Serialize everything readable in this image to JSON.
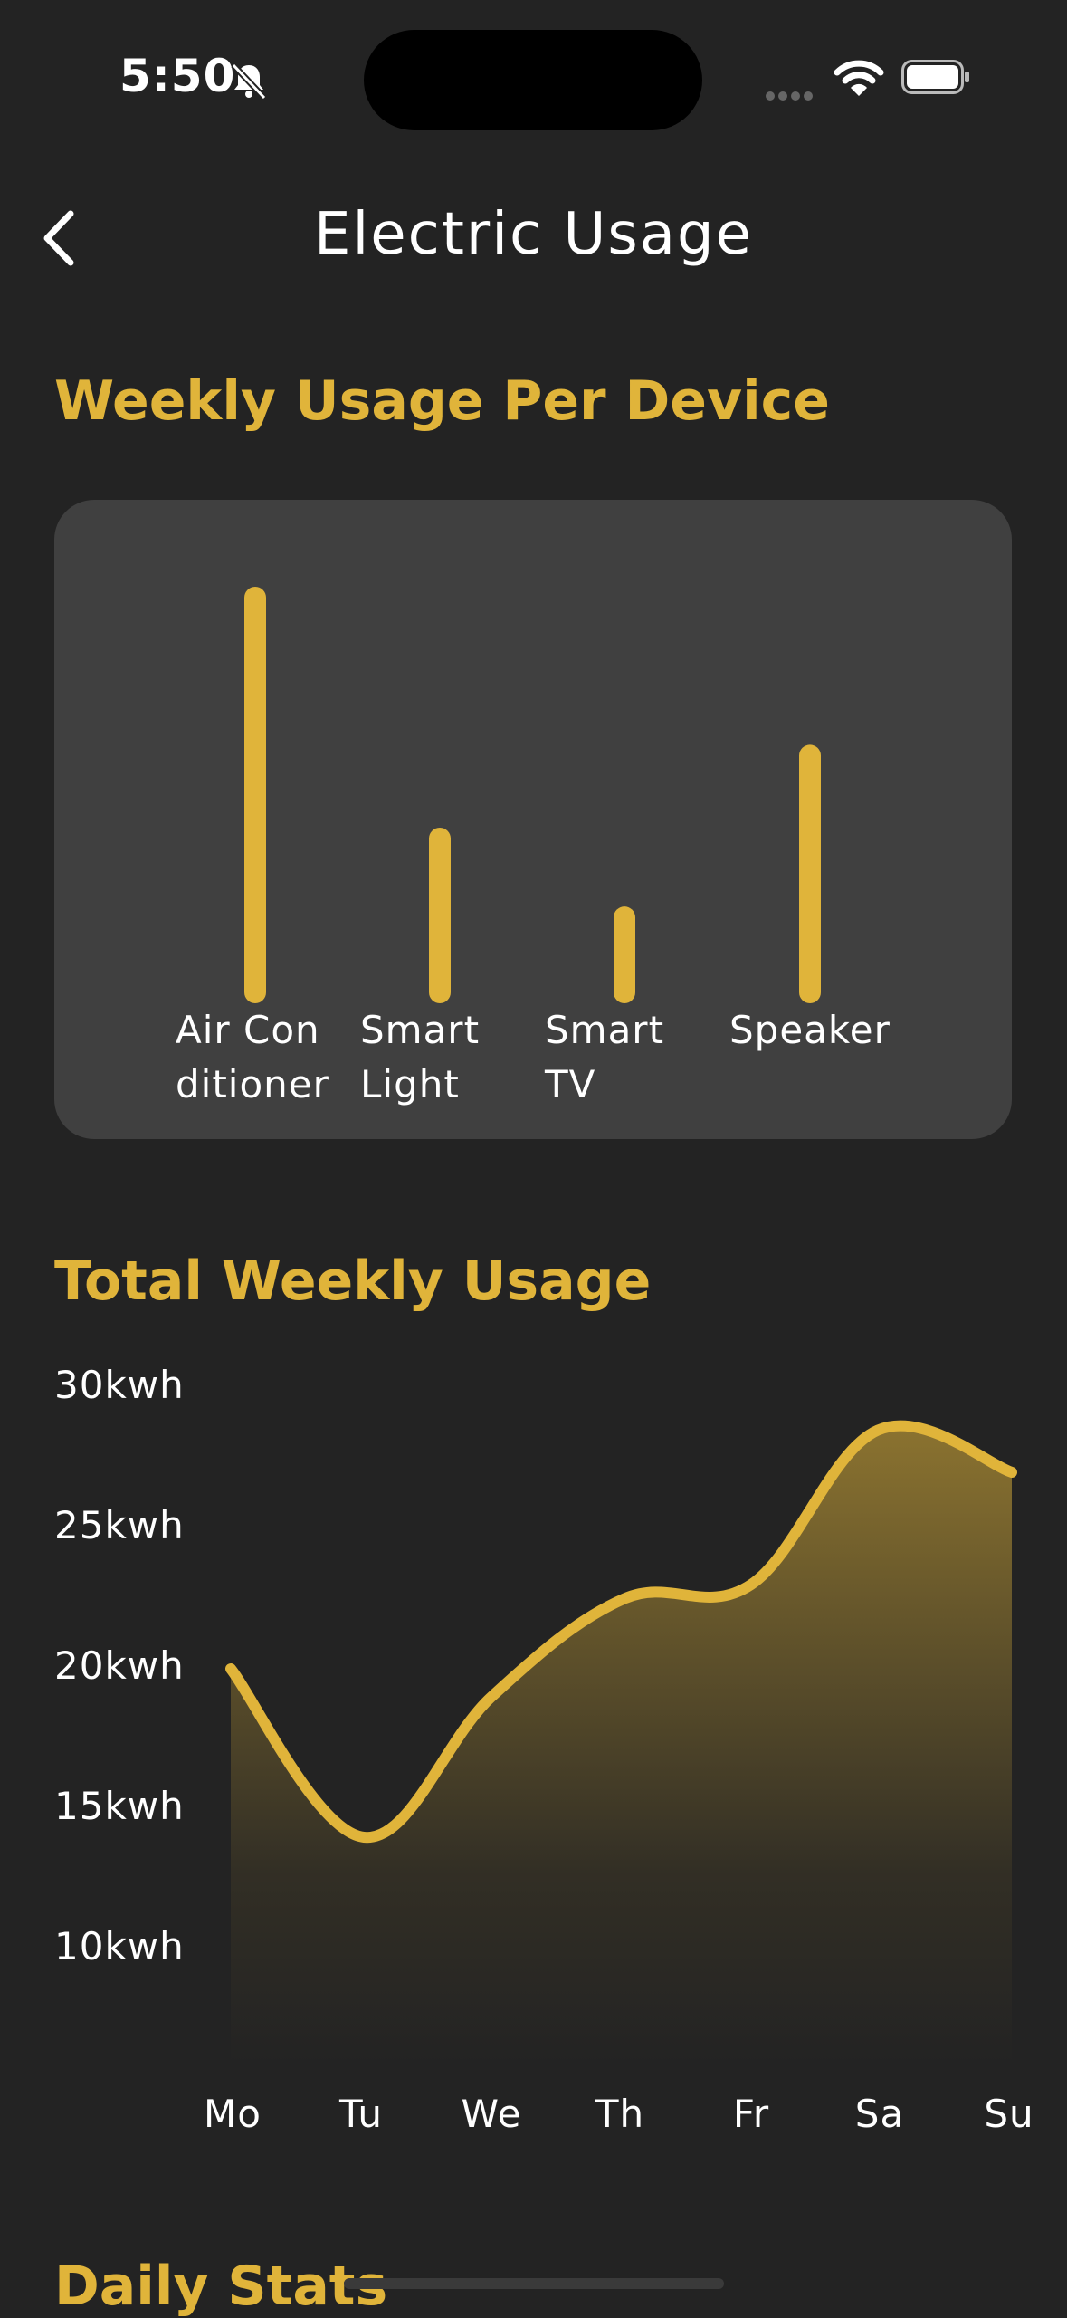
{
  "status_bar": {
    "time": "5:50"
  },
  "nav": {
    "title": "Electric Usage"
  },
  "sections": {
    "per_device": "Weekly Usage Per Device",
    "total": "Total Weekly Usage",
    "daily": "Daily Stats"
  },
  "colors": {
    "accent": "#E0B43A",
    "background": "#232323",
    "card": "#404040"
  },
  "icons": [
    "bell-slash-icon",
    "wifi-icon",
    "battery-icon",
    "chevron-left-icon"
  ],
  "chart_data": [
    {
      "type": "bar",
      "categories": [
        "Air Conditioner",
        "Smart Light",
        "Smart TV",
        "Speaker"
      ],
      "label_lines": [
        [
          "Air Con",
          "ditioner"
        ],
        [
          "Smart",
          "Light"
        ],
        [
          "Smart",
          "TV"
        ],
        [
          "Speaker"
        ]
      ],
      "values": [
        100,
        39,
        19,
        60
      ],
      "title": "Weekly Usage Per Device"
    },
    {
      "type": "area",
      "categories": [
        "Mo",
        "Tu",
        "We",
        "Th",
        "Fr",
        "Sa",
        "Su"
      ],
      "values": [
        20,
        14,
        19,
        22.5,
        23,
        28.5,
        27
      ],
      "yticks": [
        "30kwh",
        "25kwh",
        "20kwh",
        "15kwh",
        "10kwh"
      ],
      "ytick_values": [
        30,
        25,
        20,
        15,
        10
      ],
      "title": "Total Weekly Usage"
    }
  ]
}
